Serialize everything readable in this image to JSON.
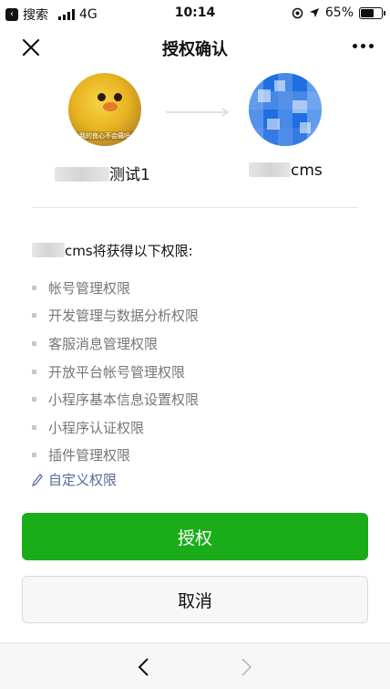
{
  "status_bar": {
    "back_app_label": "搜索",
    "network": "4G",
    "time": "10:14",
    "battery": "65%",
    "battery_level_percent": 65
  },
  "nav": {
    "title": "授权确认",
    "close_icon": "close-icon",
    "more_icon": "more-icon"
  },
  "left_account": {
    "name_suffix": "测试1",
    "avatar_caption": "我的良心不会痛吗"
  },
  "right_account": {
    "name_suffix": "cms"
  },
  "permissions": {
    "heading_suffix": "cms将获得以下权限:",
    "items": [
      "帐号管理权限",
      "开发管理与数据分析权限",
      "客服消息管理权限",
      "开放平台帐号管理权限",
      "小程序基本信息设置权限",
      "小程序认证权限",
      "插件管理权限"
    ],
    "custom_label": "自定义权限"
  },
  "buttons": {
    "authorize": "授权",
    "cancel": "取消"
  },
  "colors": {
    "primary_green": "#1aad19",
    "link_blue": "#576b95",
    "muted_text": "#777777"
  }
}
